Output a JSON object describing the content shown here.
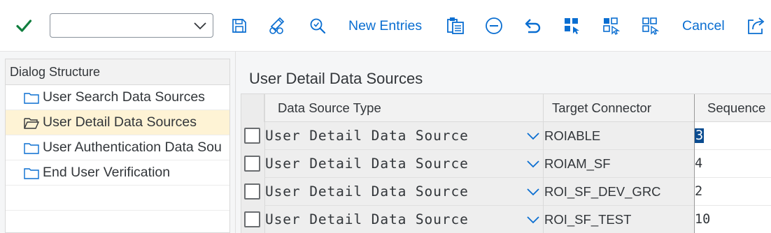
{
  "toolbar": {
    "command_field": {
      "value": "",
      "placeholder": ""
    },
    "buttons": [
      {
        "name": "enter-button",
        "icon": "checkmark-icon"
      },
      {
        "name": "save-button",
        "icon": "save-icon"
      },
      {
        "name": "display-change-button",
        "icon": "edit-glasses-icon"
      },
      {
        "name": "find-button",
        "icon": "find-icon"
      },
      {
        "name": "delete-button",
        "icon": "minus-circle-icon"
      },
      {
        "name": "undo-button",
        "icon": "undo-icon"
      },
      {
        "name": "select-all-button",
        "icon": "select-all-icon"
      },
      {
        "name": "select-block-button",
        "icon": "select-block-icon"
      },
      {
        "name": "deselect-all-button",
        "icon": "deselect-all-icon"
      },
      {
        "name": "export-button",
        "icon": "export-icon"
      }
    ],
    "new_entries_label": "New Entries",
    "cancel_label": "Cancel",
    "colors": {
      "accent": "#0a6ed1",
      "enter": "#107e3e"
    }
  },
  "dialog_structure": {
    "title": "Dialog Structure",
    "items": [
      {
        "label": "User Search Data Sources",
        "selected": false,
        "icon": "folder-icon"
      },
      {
        "label": "User Detail Data Sources",
        "selected": true,
        "icon": "folder-open-icon"
      },
      {
        "label": "User Authentication Data Sou",
        "selected": false,
        "icon": "folder-icon"
      },
      {
        "label": "End User Verification",
        "selected": false,
        "icon": "folder-icon"
      }
    ]
  },
  "main": {
    "title": "User Detail Data Sources",
    "columns": [
      "Data Source Type",
      "Target Connector",
      "Sequence"
    ],
    "rows": [
      {
        "data_source_type": "User Detail Data Source",
        "target_connector": "ROIABLE",
        "sequence": "3",
        "sequence_selected": true
      },
      {
        "data_source_type": "User Detail Data Source",
        "target_connector": "ROIAM_SF",
        "sequence": "4",
        "sequence_selected": false
      },
      {
        "data_source_type": "User Detail Data Source",
        "target_connector": "ROI_SF_DEV_GRC",
        "sequence": "2",
        "sequence_selected": false
      },
      {
        "data_source_type": "User Detail Data Source",
        "target_connector": "ROI_SF_TEST",
        "sequence": "10",
        "sequence_selected": false
      }
    ]
  }
}
